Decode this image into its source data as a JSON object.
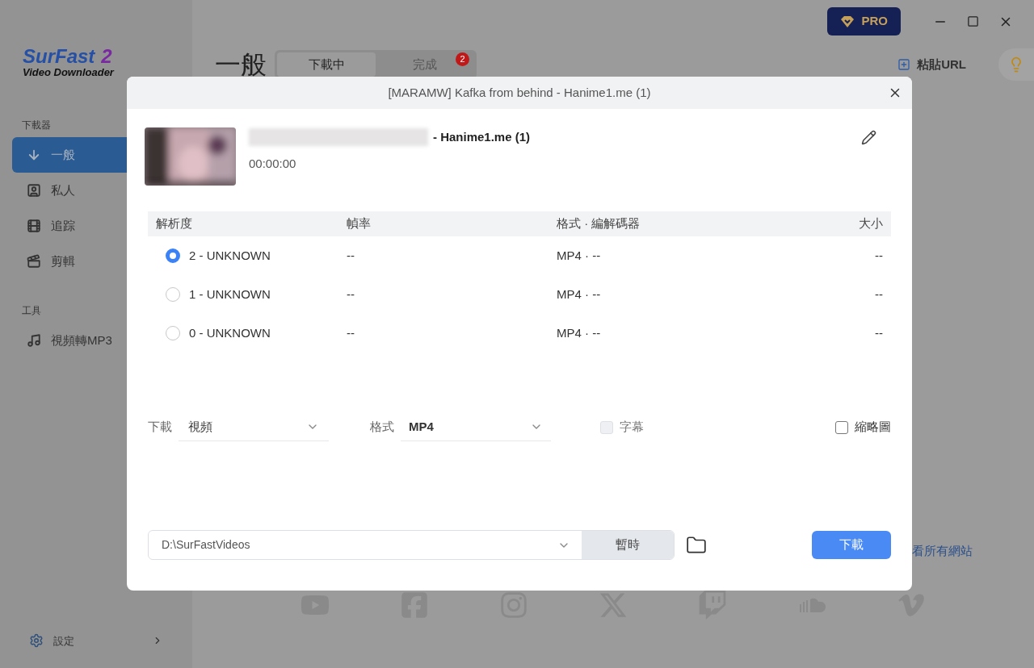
{
  "sidebar": {
    "logo_title": "SurFast",
    "logo_number": "2",
    "logo_subtitle": "Video Downloader",
    "sections": [
      {
        "heading": "下載器",
        "items": [
          {
            "label": "一般",
            "kind": "download",
            "selected": true
          },
          {
            "label": "私人",
            "kind": "person",
            "selected": false
          },
          {
            "label": "追踪",
            "kind": "track",
            "selected": false
          },
          {
            "label": "剪輯",
            "kind": "clip",
            "selected": false
          }
        ]
      },
      {
        "heading": "工具",
        "items": [
          {
            "label": "視頻轉MP3",
            "kind": "music",
            "selected": false
          }
        ]
      }
    ],
    "settings": "設定"
  },
  "header": {
    "title": "一般",
    "tabs": [
      {
        "label": "下載中",
        "selected": true
      },
      {
        "label": "完成",
        "selected": false,
        "badge": "2"
      }
    ],
    "pro": "PRO",
    "paste_url": "粘貼URL"
  },
  "see_all_sites": "看所有網站",
  "dialog": {
    "title": "[MARAMW] Kafka from behind - Hanime1.me (1)",
    "video_suffix": "- Hanime1.me (1)",
    "duration": "00:00:00",
    "columns": [
      "解析度",
      "幀率",
      "格式 · 編解碼器",
      "大小"
    ],
    "rows": [
      {
        "resolution": "2 - UNKNOWN",
        "frame_rate": "--",
        "format": "MP4 · --",
        "size": "--",
        "selected": true
      },
      {
        "resolution": "1 - UNKNOWN",
        "frame_rate": "--",
        "format": "MP4 · --",
        "size": "--",
        "selected": false
      },
      {
        "resolution": "0 - UNKNOWN",
        "frame_rate": "--",
        "format": "MP4 · --",
        "size": "--",
        "selected": false
      }
    ],
    "download_label": "下載",
    "download_value": "視頻",
    "format_label": "格式",
    "format_value": "MP4",
    "subtitles": {
      "label": "字幕",
      "checked": false,
      "disabled": true
    },
    "thumbnail": {
      "label": "縮略圖",
      "checked": false,
      "disabled": false
    },
    "path": "D:\\SurFastVideos",
    "temp_button": "暫時",
    "download_button": "下載"
  }
}
